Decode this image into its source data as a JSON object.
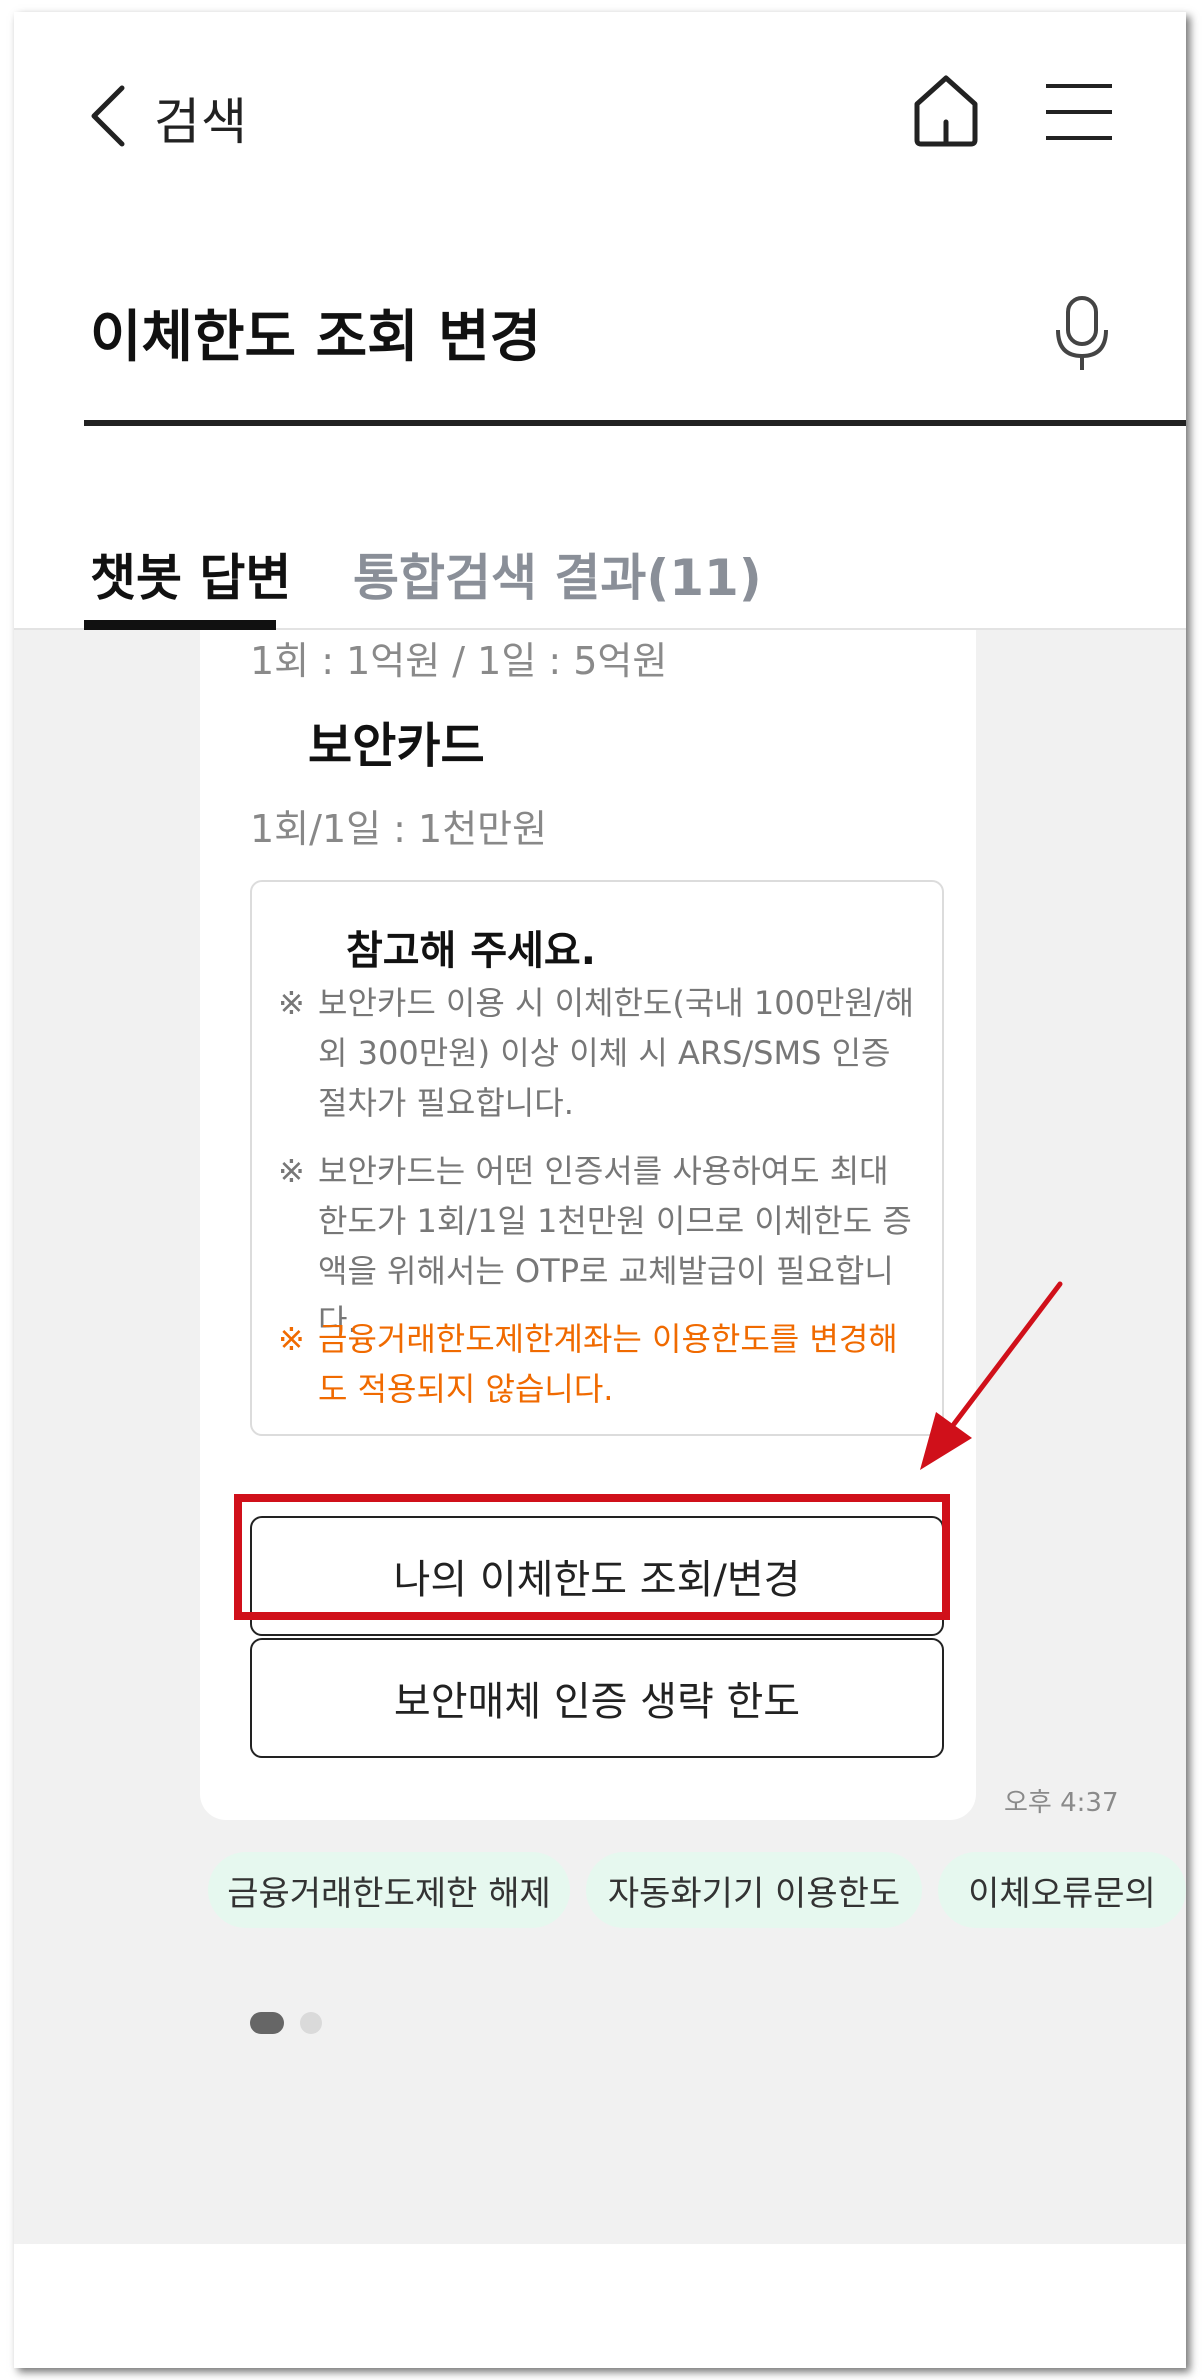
{
  "header": {
    "back_icon": "chevron-left-icon",
    "title": "검색",
    "home_icon": "home-icon",
    "menu_icon": "hamburger-menu-icon"
  },
  "search": {
    "query": "이체한도 조회 변경",
    "mic_icon": "microphone-icon"
  },
  "tabs": [
    {
      "label": "챗봇 답변",
      "active": true
    },
    {
      "label": "통합검색 결과(11)",
      "active": false
    }
  ],
  "answer": {
    "cut_off_text": "1회 : 1억원 / 1일 : 5억원",
    "section_title": "보안카드",
    "section_limit": "1회/1일 : 1천만원",
    "note": {
      "title": "참고해 주세요.",
      "marker": "※",
      "items": [
        {
          "text": "보안카드 이용 시 이체한도(국내 100만원/해외 300만원) 이상 이체 시 ARS/SMS 인증 절차가 필요합니다.",
          "color": "#777777"
        },
        {
          "text": "보안카드는 어떤 인증서를 사용하여도 최대 한도가 1회/1일 1천만원 이므로 이체한도 증액을 위해서는 OTP로 교체발급이 필요합니다.",
          "color": "#777777"
        },
        {
          "text": "금융거래한도제한계좌는 이용한도를 변경해도 적용되지 않습니다.",
          "color": "#f06a00"
        }
      ]
    },
    "buttons": [
      {
        "label": "나의 이체한도 조회/변경",
        "highlighted": true
      },
      {
        "label": "보안매체 인증 생략 한도",
        "highlighted": false
      }
    ],
    "time": "오후 4:37"
  },
  "chips": [
    "금융거래한도제한 해제",
    "자동화기기 이용한도",
    "이체오류문의"
  ],
  "pagination": {
    "current": 1,
    "total": 2
  },
  "colors": {
    "highlight": "#d0101a",
    "chip_bg": "#e6f8ef",
    "warning": "#f06a00"
  }
}
